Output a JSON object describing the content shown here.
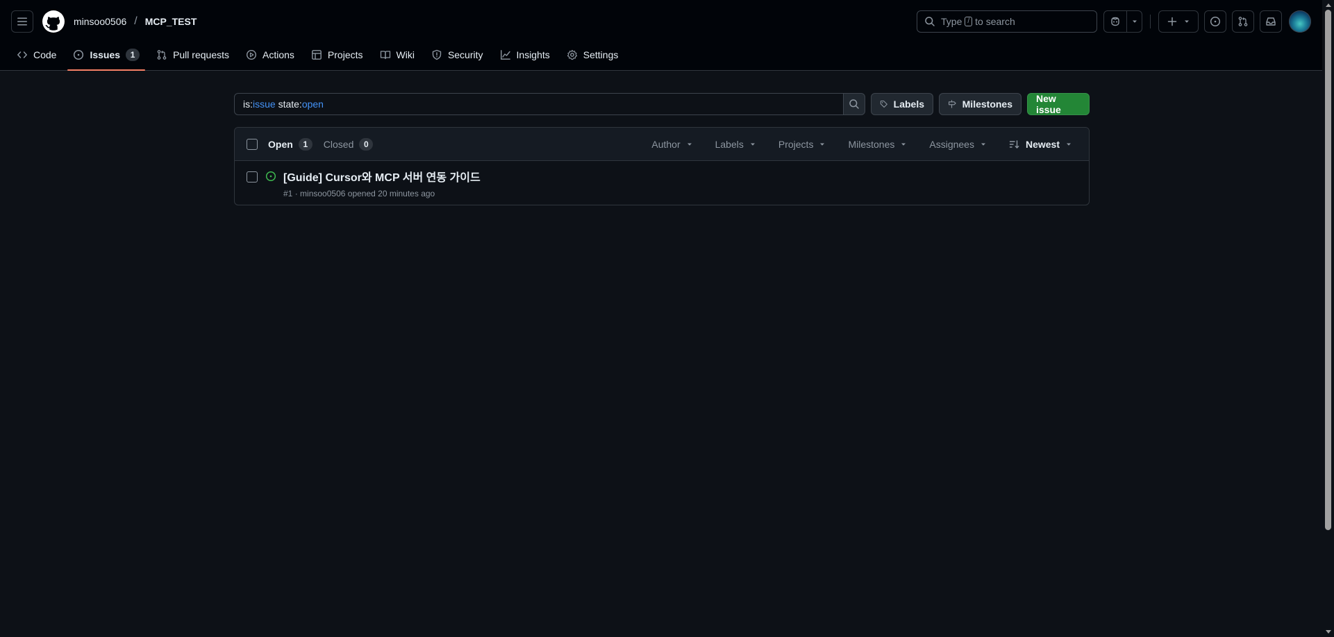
{
  "header": {
    "owner": "minsoo0506",
    "separator": "/",
    "repo": "MCP_TEST",
    "search": {
      "pre": "Type",
      "key": "/",
      "post": "to search"
    }
  },
  "tabs": [
    {
      "label": "Code",
      "icon": "code-icon"
    },
    {
      "label": "Issues",
      "icon": "issue-opened-icon",
      "count": "1",
      "selected": true
    },
    {
      "label": "Pull requests",
      "icon": "git-pull-request-icon"
    },
    {
      "label": "Actions",
      "icon": "play-icon"
    },
    {
      "label": "Projects",
      "icon": "table-icon"
    },
    {
      "label": "Wiki",
      "icon": "book-icon"
    },
    {
      "label": "Security",
      "icon": "shield-icon"
    },
    {
      "label": "Insights",
      "icon": "graph-icon"
    },
    {
      "label": "Settings",
      "icon": "gear-icon"
    }
  ],
  "filter": {
    "q1_key": "is:",
    "q1_val": "issue",
    "q2_key": "state:",
    "q2_val": "open",
    "labels_btn": "Labels",
    "milestones_btn": "Milestones",
    "new_issue_btn": "New issue"
  },
  "list": {
    "open_label": "Open",
    "open_count": "1",
    "closed_label": "Closed",
    "closed_count": "0",
    "filters": [
      "Author",
      "Labels",
      "Projects",
      "Milestones",
      "Assignees"
    ],
    "sort_label": "Newest"
  },
  "issues": [
    {
      "title": "[Guide] Cursor와 MCP 서버 연동 가이드",
      "number": "#1",
      "sep": "·",
      "author": "minsoo0506",
      "opened": "opened 20 minutes ago"
    }
  ],
  "colors": {
    "accent_underline": "#f78166",
    "open_green": "#3fb950",
    "primary_button": "#238636",
    "link_blue": "#4493f8"
  }
}
